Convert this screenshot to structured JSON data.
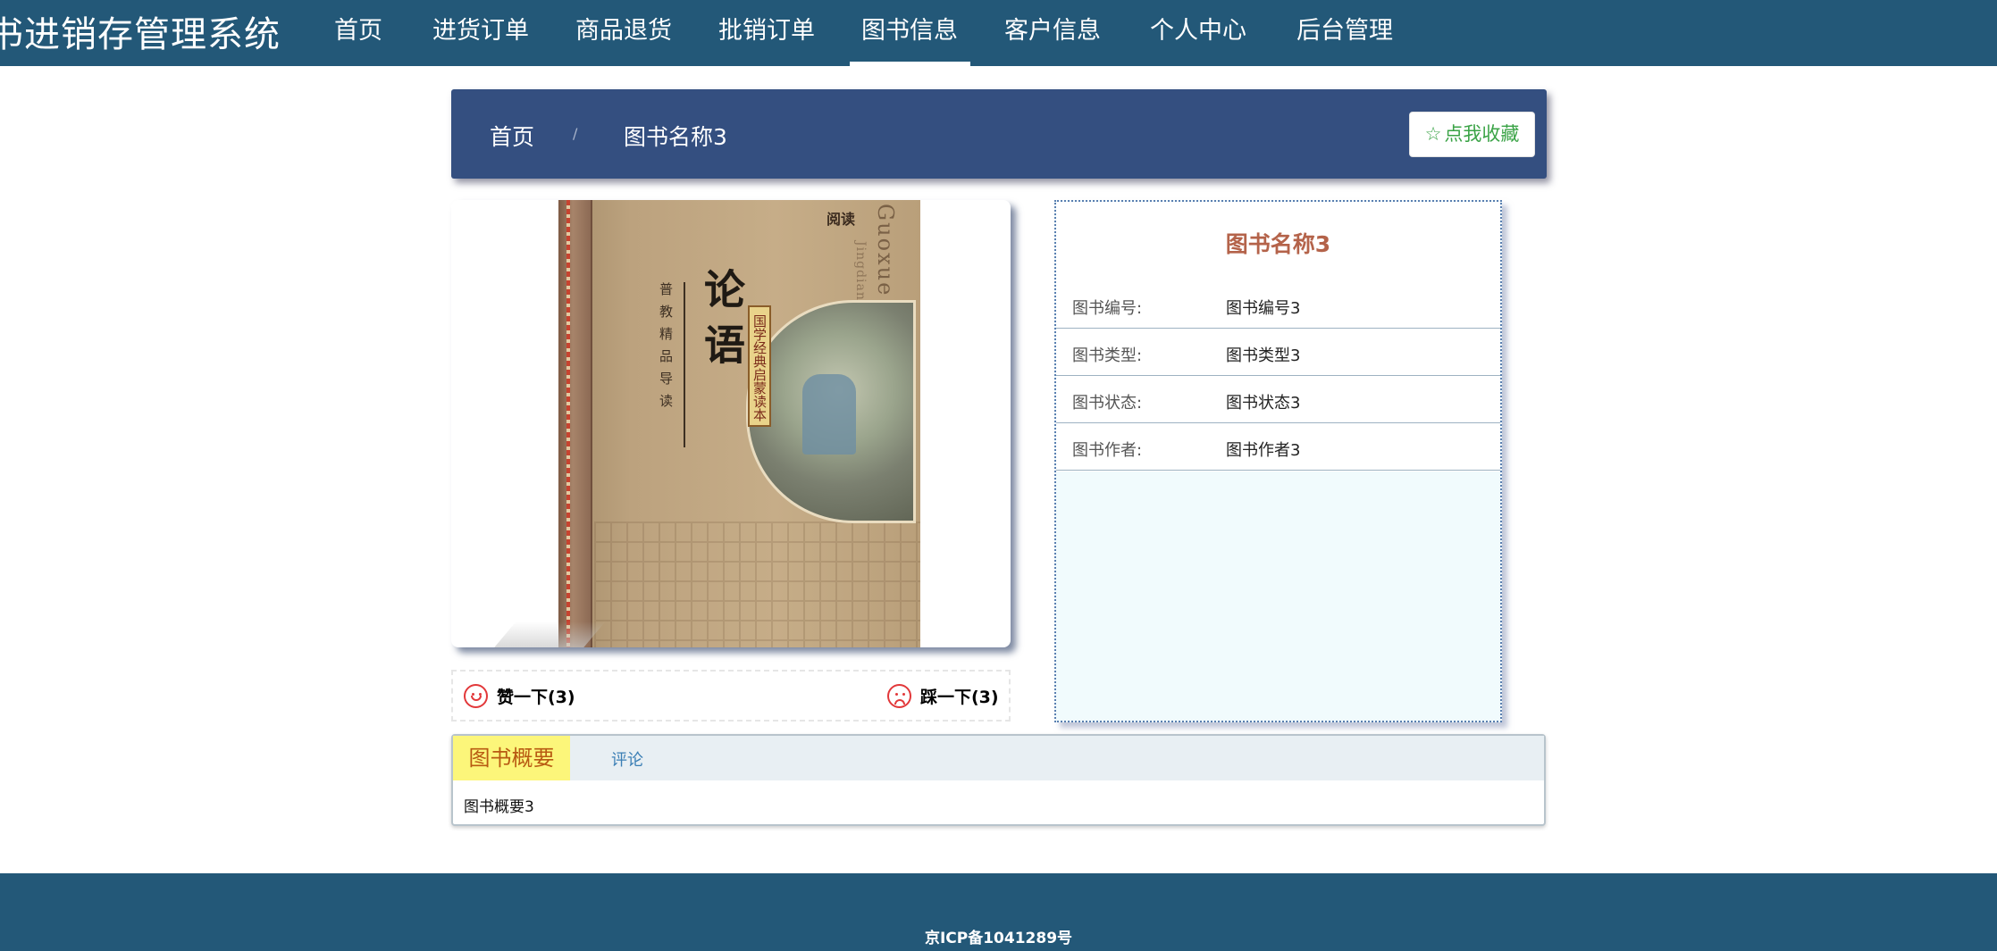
{
  "header": {
    "site_title": "书进销存管理系统",
    "nav": [
      {
        "label": "首页"
      },
      {
        "label": "进货订单"
      },
      {
        "label": "商品退货"
      },
      {
        "label": "批销订单"
      },
      {
        "label": "图书信息",
        "active": true
      },
      {
        "label": "客户信息"
      },
      {
        "label": "个人中心"
      },
      {
        "label": "后台管理"
      }
    ]
  },
  "breadcrumb": {
    "home": "首页",
    "separator": "/",
    "current": "图书名称3",
    "favorite_icon": "star-outline-icon",
    "favorite_label": "点我收藏"
  },
  "cover": {
    "title": "论语",
    "series_badge": "国学经典启蒙读本",
    "side_text": "普教精品导读",
    "english_title": "Guoxue",
    "english_subtitle": "Jingdian",
    "brand": "阅读"
  },
  "votes": {
    "like_icon": "smile-face-icon",
    "like_label": "赞一下(3)",
    "dislike_icon": "sad-face-icon",
    "dislike_label": "踩一下(3)"
  },
  "book_info": {
    "title": "图书名称3",
    "rows": [
      {
        "label": "图书编号:",
        "value": "图书编号3"
      },
      {
        "label": "图书类型:",
        "value": "图书类型3"
      },
      {
        "label": "图书状态:",
        "value": "图书状态3"
      },
      {
        "label": "图书作者:",
        "value": "图书作者3"
      }
    ]
  },
  "tabs": {
    "items": [
      {
        "label": "图书概要",
        "active": true
      },
      {
        "label": "评论"
      }
    ],
    "content": "图书概要3"
  },
  "footer": {
    "icp": "京ICP备1041289号"
  },
  "colors": {
    "nav_bg": "#235878",
    "breadcrumb_bg": "#344f80",
    "favorite_text": "#3aa346",
    "info_title": "#b4634a",
    "tab_active_bg": "#fcf67a",
    "vote_icon": "#e2383a"
  }
}
